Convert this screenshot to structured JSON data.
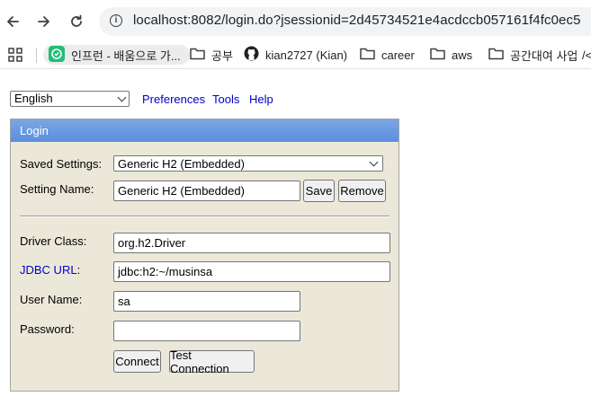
{
  "browser": {
    "url": "localhost:8082/login.do?jsessionid=2d45734521e4acdccb057161f4fc0ec5",
    "bookmarks": [
      {
        "label": "인프런 - 배움으로 가...",
        "icon": "inflearn-icon"
      },
      {
        "label": "공부",
        "icon": "folder-icon"
      },
      {
        "label": "kian2727 (Kian)",
        "icon": "github-icon"
      },
      {
        "label": "career",
        "icon": "folder-icon"
      },
      {
        "label": "aws",
        "icon": "folder-icon"
      },
      {
        "label": "공간대여 사업",
        "icon": "folder-icon"
      },
      {
        "label": "/<",
        "icon": ""
      }
    ]
  },
  "toolbar": {
    "language": "English",
    "links": [
      "Preferences",
      "Tools",
      "Help"
    ]
  },
  "login": {
    "title": "Login",
    "saved_settings_label": "Saved Settings:",
    "saved_settings_value": "Generic H2 (Embedded)",
    "setting_name_label": "Setting Name:",
    "setting_name_value": "Generic H2 (Embedded)",
    "save_label": "Save",
    "remove_label": "Remove",
    "driver_class_label": "Driver Class:",
    "driver_class_value": "org.h2.Driver",
    "jdbc_url_label": "JDBC URL",
    "jdbc_url_colon": ":",
    "jdbc_url_value": "jdbc:h2:~/musinsa",
    "user_name_label": "User Name:",
    "user_name_value": "sa",
    "password_label": "Password:",
    "password_value": "",
    "connect_label": "Connect",
    "test_connection_label": "Test Connection"
  }
}
